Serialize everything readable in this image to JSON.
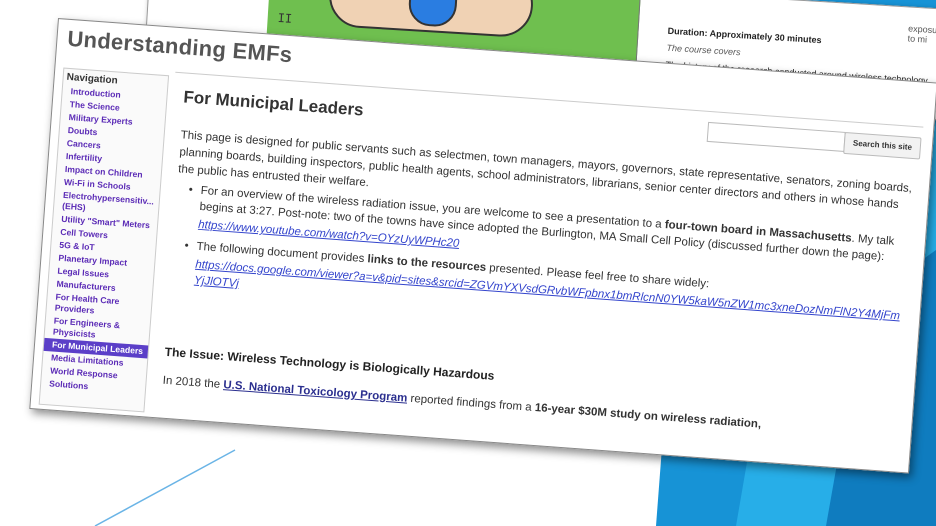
{
  "top_screenshot": {
    "thumb_label": "II",
    "duration": "Duration: Approximately 30 minutes",
    "course_covers": "The course covers",
    "history": "The history of the research conducted around wireless technology",
    "edge_text": "exposure to mi"
  },
  "site": {
    "title": "Understanding EMFs"
  },
  "nav": {
    "heading": "Navigation",
    "items": [
      "Introduction",
      "The Science",
      "Military Experts",
      "Doubts",
      "Cancers",
      "Infertility",
      "Impact on Children",
      "Wi-Fi in Schools",
      "Electrohypersensitiv... (EHS)",
      "Utility \"Smart\" Meters",
      "Cell Towers",
      "5G & IoT",
      "Planetary Impact",
      "Legal Issues",
      "Manufacturers",
      "For Health Care Providers",
      "For Engineers & Physicists",
      "For Municipal Leaders",
      "Media Limitations",
      "World Response",
      "Solutions"
    ],
    "active_index": 17
  },
  "search": {
    "button_label": "Search this site",
    "value": ""
  },
  "page": {
    "title": "For Municipal Leaders",
    "intro": "This page is designed for public servants such as selectmen, town managers, mayors, governors, state representative, senators, zoning boards, planning boards, building inspectors, public health agents, school administrators, librarians, senior center directors and others in whose hands the public has entrusted their welfare.",
    "bullet1_a": "For an overview of the wireless radiation issue, you are welcome to see a presentation to a",
    "bullet1_bold1": "four-town board in Massachusetts",
    "bullet1_b": ". My talk begins at 3:27. Post-note: two of the towns have since adopted the Burlington, MA Small Cell Policy (discussed further down the page):",
    "bullet1_link": "https://www.youtube.com/watch?v=OYzUyWPHc20",
    "bullet2_a": "The following document provides",
    "bullet2_bold": "links to the resources",
    "bullet2_b": "presented. Please feel free to share widely:",
    "bullet2_link": "https://docs.google.com/viewer?a=v&pid=sites&srcid=ZGVmYXVsdGRvbWFpbnx1bmRlcnN0YW5kaW5nZW1mc3xneDozNmFlN2Y4MjFmYjJlOTVj",
    "issue_heading": "The Issue: Wireless Technology is Biologically Hazardous",
    "para2_a": "In 2018 the",
    "para2_link": "U.S. National Toxicology Program",
    "para2_b": "reported findings from a",
    "para2_bold": "16-year $30M study on wireless radiation,"
  },
  "colors": {
    "accent_blue": "#1aa3e6",
    "nav_link": "#5b2bb6",
    "nav_active": "#5b3fc8"
  }
}
